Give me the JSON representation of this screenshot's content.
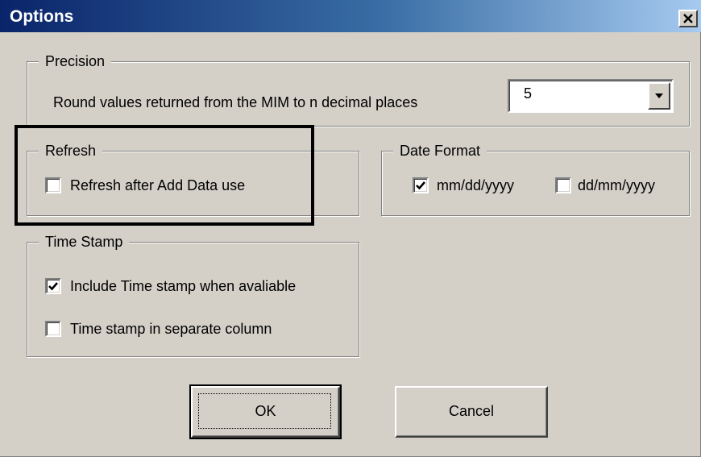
{
  "window": {
    "title": "Options",
    "close_icon": "close-icon"
  },
  "precision": {
    "group_label": "Precision",
    "description": "Round values returned from the MIM to n decimal places",
    "decimal_places": "5",
    "dropdown_icon": "chevron-down-icon"
  },
  "refresh": {
    "group_label": "Refresh",
    "refresh_after_add_data": {
      "label": "Refresh after Add Data use",
      "checked": false
    }
  },
  "date_format": {
    "group_label": "Date Format",
    "mmddyyyy": {
      "label": "mm/dd/yyyy",
      "checked": true
    },
    "ddmmyyyy": {
      "label": "dd/mm/yyyy",
      "checked": false
    }
  },
  "time_stamp": {
    "group_label": "Time Stamp",
    "include_time_stamp": {
      "label": "Include Time stamp when avaliable",
      "checked": true
    },
    "separate_column": {
      "label": "Time stamp in separate column",
      "checked": false
    }
  },
  "buttons": {
    "ok": "OK",
    "cancel": "Cancel"
  },
  "colors": {
    "dialog_bg": "#d4d0c8",
    "titlebar_start": "#0a246a",
    "titlebar_end": "#a6caf0"
  }
}
